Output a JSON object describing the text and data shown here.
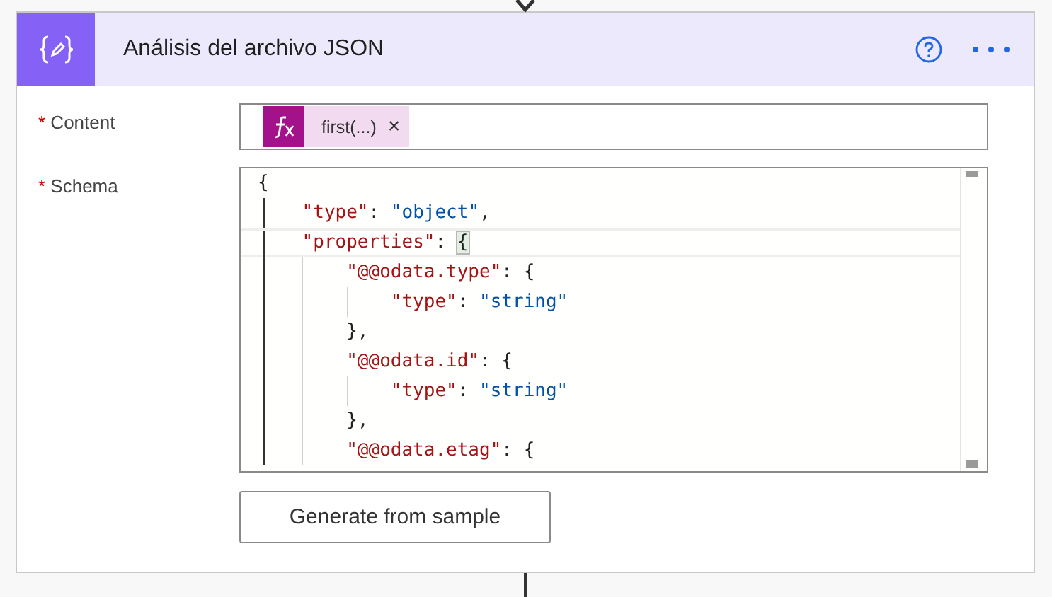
{
  "action": {
    "title": "Análisis del archivo JSON"
  },
  "fields": [
    {
      "label": "Content",
      "required": true,
      "required_mark": "*",
      "kind": "token",
      "token": {
        "label": "first(...)",
        "remove": "×"
      }
    },
    {
      "label": "Schema",
      "required": true,
      "required_mark": "*",
      "kind": "code",
      "lines": [
        {
          "current": false,
          "tokens": [
            {
              "kind": "punct",
              "text": "{"
            }
          ]
        },
        {
          "current": false,
          "tokens": [
            {
              "kind": "key",
              "text": "    \"type\""
            },
            {
              "kind": "punct",
              "text": ": "
            },
            {
              "kind": "string",
              "text": "\"object\""
            },
            {
              "kind": "punct",
              "text": ","
            }
          ]
        },
        {
          "current": true,
          "tokens": [
            {
              "kind": "key",
              "text": "    \"properties\""
            },
            {
              "kind": "punct",
              "text": ": "
            },
            {
              "kind": "match",
              "text": "{"
            }
          ]
        },
        {
          "current": false,
          "tokens": [
            {
              "kind": "key",
              "text": "        \"@@odata.type\""
            },
            {
              "kind": "punct",
              "text": ": {"
            }
          ]
        },
        {
          "current": false,
          "tokens": [
            {
              "kind": "key",
              "text": "            \"type\""
            },
            {
              "kind": "punct",
              "text": ": "
            },
            {
              "kind": "string",
              "text": "\"string\""
            }
          ]
        },
        {
          "current": false,
          "tokens": [
            {
              "kind": "punct",
              "text": "        },"
            }
          ]
        },
        {
          "current": false,
          "tokens": [
            {
              "kind": "key",
              "text": "        \"@@odata.id\""
            },
            {
              "kind": "punct",
              "text": ": {"
            }
          ]
        },
        {
          "current": false,
          "tokens": [
            {
              "kind": "key",
              "text": "            \"type\""
            },
            {
              "kind": "punct",
              "text": ": "
            },
            {
              "kind": "string",
              "text": "\"string\""
            }
          ]
        },
        {
          "current": false,
          "tokens": [
            {
              "kind": "punct",
              "text": "        },"
            }
          ]
        },
        {
          "current": false,
          "tokens": [
            {
              "kind": "key",
              "text": "        \"@@odata.etag\""
            },
            {
              "kind": "punct",
              "text": ": {"
            }
          ]
        }
      ]
    }
  ],
  "button": "Generate from sample"
}
